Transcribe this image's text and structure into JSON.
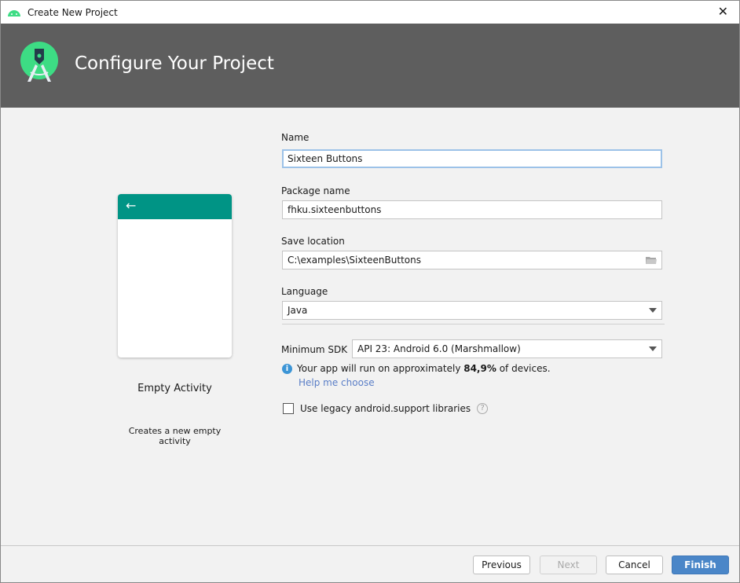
{
  "window": {
    "title": "Create New Project",
    "close": "✕"
  },
  "header": {
    "title": "Configure Your Project"
  },
  "template": {
    "name": "Empty Activity",
    "description": "Creates a new empty activity",
    "back": "←",
    "accent": "#009485"
  },
  "form": {
    "name_label": "Name",
    "name_value": "Sixteen Buttons",
    "package_label": "Package name",
    "package_value": "fhku.sixteenbuttons",
    "location_label": "Save location",
    "location_value": "C:\\examples\\SixteenButtons",
    "language_label": "Language",
    "language_value": "Java",
    "sdk_label": "Minimum SDK",
    "sdk_value": "API 23: Android 6.0 (Marshmallow)",
    "info_prefix": "Your app will run on approximately ",
    "info_percent": "84,9%",
    "info_suffix": " of devices.",
    "help_link": "Help me choose",
    "legacy_label": "Use legacy android.support libraries",
    "legacy_checked": false,
    "help_icon": "?"
  },
  "footer": {
    "previous": "Previous",
    "next": "Next",
    "cancel": "Cancel",
    "finish": "Finish",
    "finish_color": "#4a86c8"
  }
}
